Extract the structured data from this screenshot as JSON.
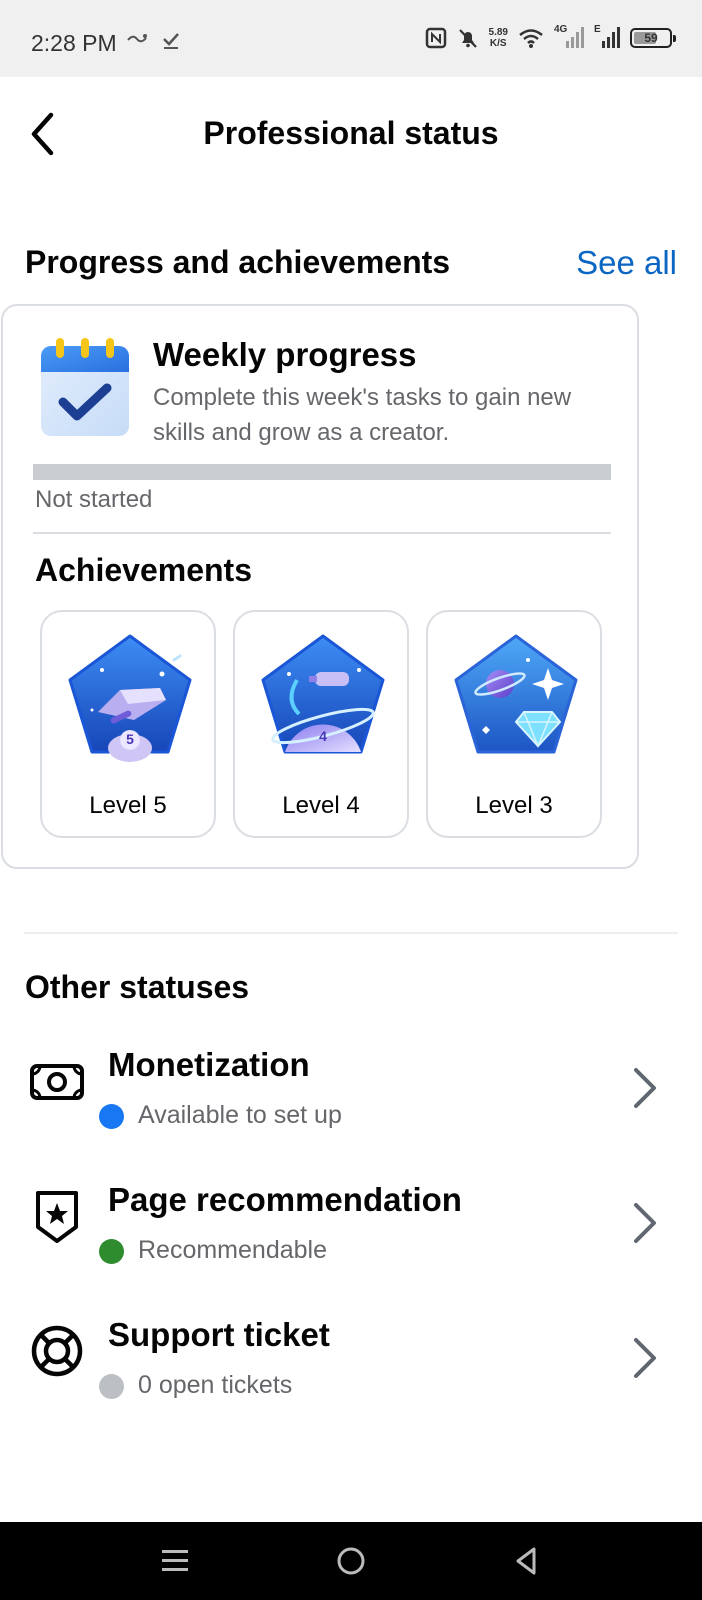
{
  "status_bar": {
    "time": "2:28 PM",
    "net_speed_top": "5.89",
    "net_speed_bottom": "K/S",
    "net_4g": "4G",
    "net_e": "E",
    "battery": "59"
  },
  "header": {
    "title": "Professional status"
  },
  "progress_section": {
    "title": "Progress and achievements",
    "see_all": "See all",
    "weekly": {
      "title": "Weekly progress",
      "description": "Complete this week's tasks to gain new skills and grow as a creator.",
      "progress_fraction": 0,
      "status": "Not started"
    },
    "achievements_title": "Achievements",
    "badges": [
      {
        "label": "Level 5",
        "number": "5"
      },
      {
        "label": "Level 4",
        "number": "4"
      },
      {
        "label": "Level 3"
      }
    ]
  },
  "other_statuses": {
    "title": "Other statuses",
    "items": [
      {
        "name": "Monetization",
        "sub": "Available to set up",
        "dot_color": "#1877f2",
        "icon": "money-icon"
      },
      {
        "name": "Page recommendation",
        "sub": "Recommendable",
        "dot_color": "#2e8b2e",
        "icon": "shield-star-icon"
      },
      {
        "name": "Support ticket",
        "sub": "0 open tickets",
        "dot_color": "#bcc0c4",
        "icon": "lifebuoy-icon"
      }
    ]
  },
  "colors": {
    "accent": "#0a66c2",
    "progress_track": "#c9ccd1",
    "secondary_text": "#65676b"
  }
}
